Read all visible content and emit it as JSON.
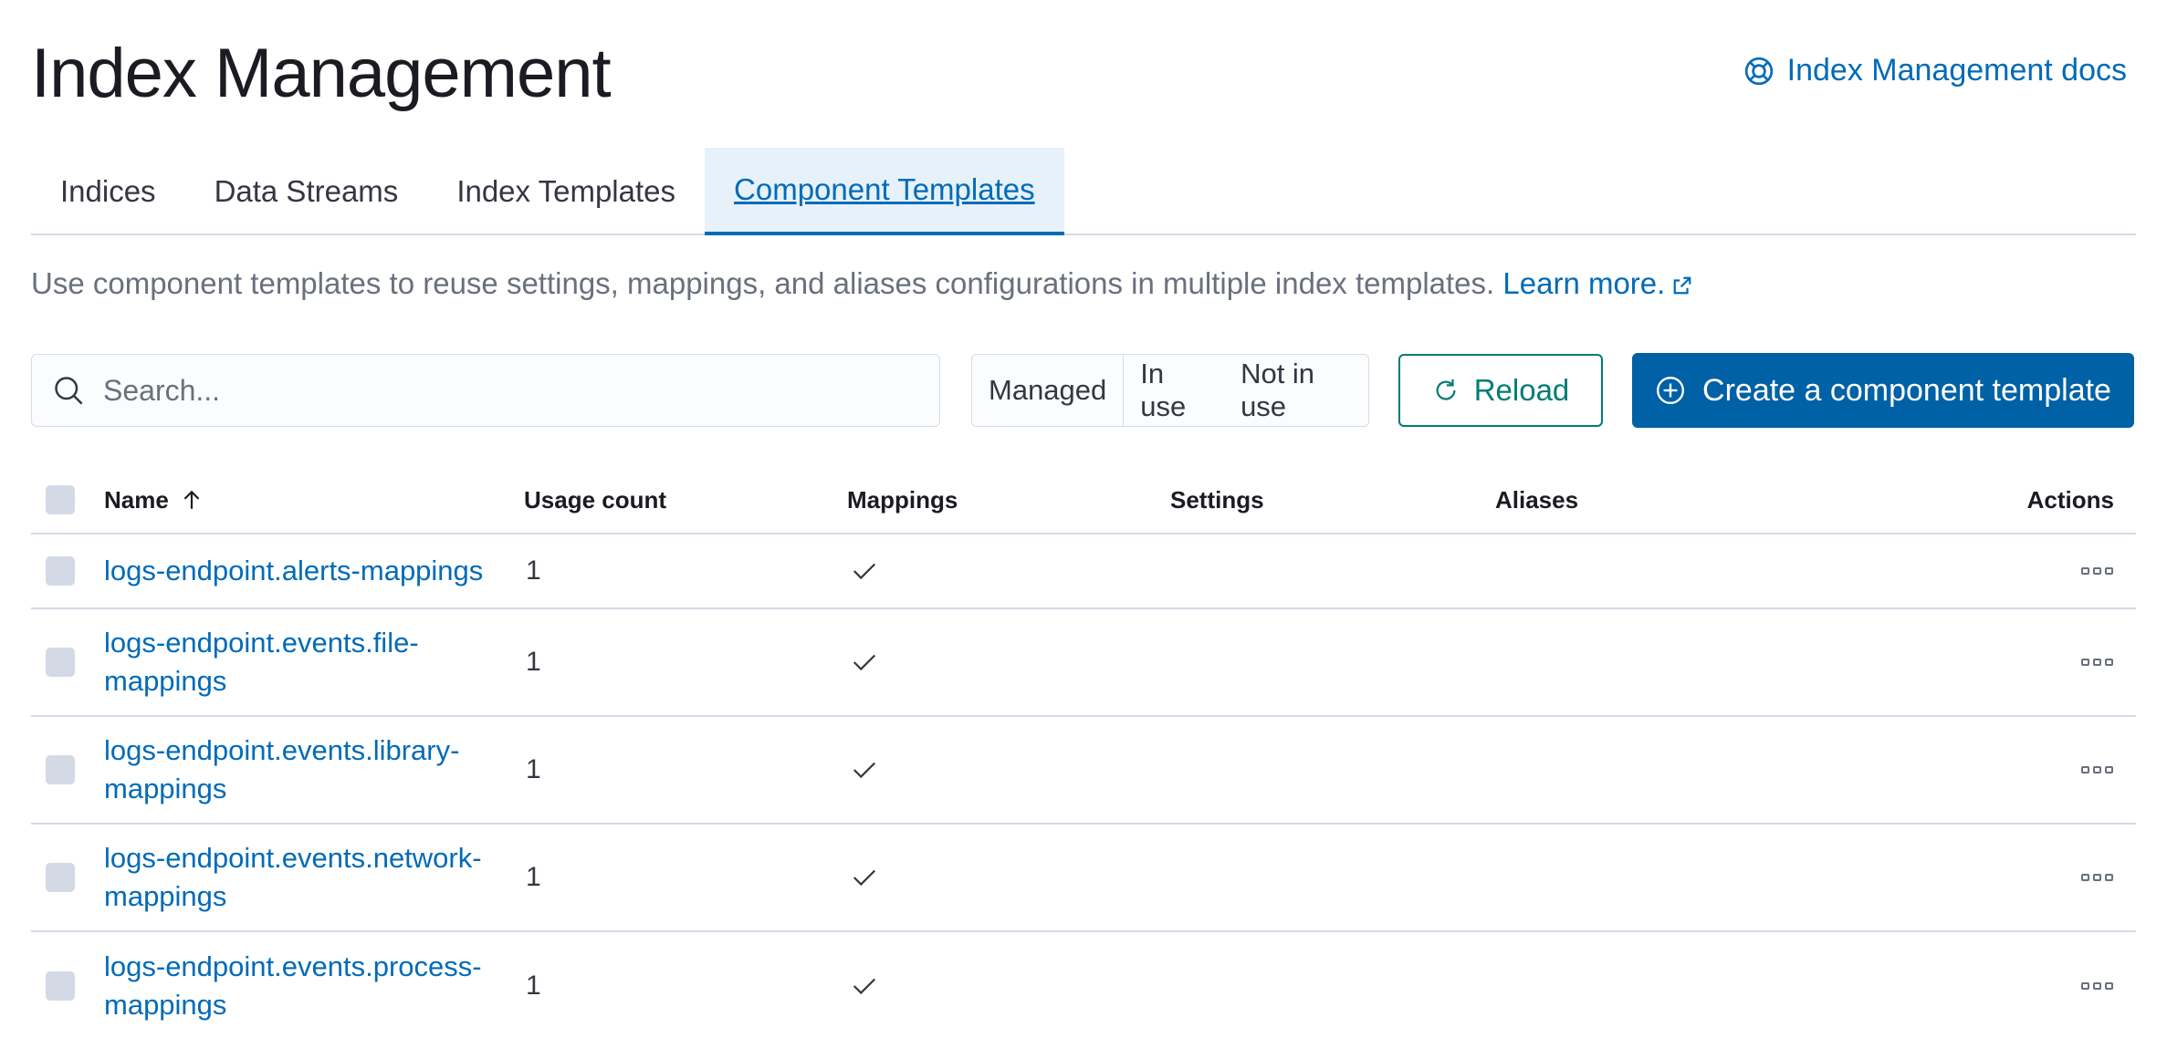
{
  "header": {
    "title": "Index Management",
    "docs_link": "Index Management docs"
  },
  "tabs": [
    {
      "label": "Indices",
      "active": false
    },
    {
      "label": "Data Streams",
      "active": false
    },
    {
      "label": "Index Templates",
      "active": false
    },
    {
      "label": "Component Templates",
      "active": true
    }
  ],
  "description": {
    "text": "Use component templates to reuse settings, mappings, and aliases configurations in multiple index templates.",
    "link": "Learn more."
  },
  "toolbar": {
    "search_placeholder": "Search...",
    "filters": [
      "Managed",
      "In use",
      "Not in use"
    ],
    "reload_label": "Reload",
    "create_label": "Create a component template"
  },
  "table": {
    "columns": {
      "name": "Name",
      "usage": "Usage count",
      "mappings": "Mappings",
      "settings": "Settings",
      "aliases": "Aliases",
      "actions": "Actions"
    },
    "rows": [
      {
        "name": "logs-endpoint.alerts-mappings",
        "usage": "1",
        "mappings": true,
        "settings": false,
        "aliases": false
      },
      {
        "name": "logs-endpoint.events.file-mappings",
        "usage": "1",
        "mappings": true,
        "settings": false,
        "aliases": false
      },
      {
        "name": "logs-endpoint.events.library-mappings",
        "usage": "1",
        "mappings": true,
        "settings": false,
        "aliases": false
      },
      {
        "name": "logs-endpoint.events.network-mappings",
        "usage": "1",
        "mappings": true,
        "settings": false,
        "aliases": false
      },
      {
        "name": "logs-endpoint.events.process-mappings",
        "usage": "1",
        "mappings": true,
        "settings": false,
        "aliases": false
      }
    ]
  },
  "colors": {
    "link": "#006bb8",
    "primary_button": "#0061a6",
    "reload_accent": "#017d73",
    "active_tab_bg": "#e6f1fa"
  }
}
